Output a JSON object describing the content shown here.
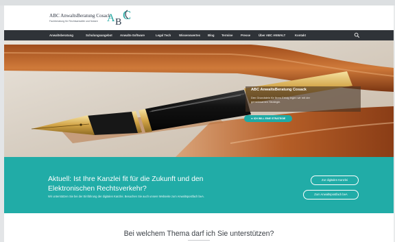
{
  "header": {
    "brand_name": "ABC AnwaltsBeratung Cosack",
    "brand_tagline": "Fachberatung für Rechtsanwälte und Notare",
    "logo_letters": "ABC",
    "colors": {
      "logo_accent": "#26a9a3",
      "logo_dark": "#2a3848"
    }
  },
  "nav": {
    "items": [
      "Anwaltsberatung",
      "Schulungsangebot",
      "Anwalts-Software",
      "Legal Tech",
      "Wissenswertes",
      "Blog",
      "Termine",
      "Presse",
      "Über ABC ANWALT",
      "Kontakt"
    ],
    "search_icon": "search-icon",
    "background": "#2f3338"
  },
  "hero": {
    "title": "ABC AnwaltsBeratung Cosack",
    "text_line_1": "Den Grundstein für Ihren Erfolg legen wir mit der",
    "text_line_2": "gemeinsamen Strategie.",
    "cta": "ICH WILL EINE STRATEGIE",
    "cta_color": "#1faaa5"
  },
  "band": {
    "headline_line_1": "Aktuell: Ist Ihre Kanzlei fit für die Zukunft und den",
    "headline_line_2": "Elektronischen Rechtsverkehr?",
    "subtext": "Wir unterstützen Sie bei der Einführung der digitalen Kanzlei. Besuchen Sie auch unsere Webseite zum Anwaltspostfach beA.",
    "button_1": "Zur digitalen Kanzlei",
    "button_2": "Zum Anwaltspostfach beA",
    "background": "#21aca7"
  },
  "below": {
    "title": "Bei welchem Thema darf ich Sie unterstützen?"
  }
}
